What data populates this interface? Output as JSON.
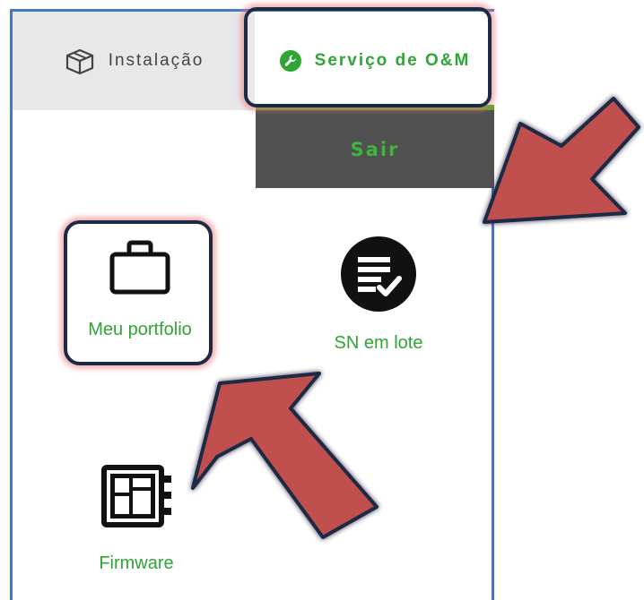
{
  "tabs": {
    "installation_label": "Instalação",
    "om_label": "Serviço de O&M"
  },
  "dropdown": {
    "exit_label": "Sair"
  },
  "tiles": {
    "portfolio_label": "Meu portfolio",
    "batch_sn_label": "SN em lote",
    "firmware_label": "Firmware"
  },
  "icons": {
    "installation": "box-icon",
    "om": "wrench-icon",
    "portfolio": "briefcase-icon",
    "batch_sn": "list-check-icon",
    "firmware": "chip-icon"
  },
  "colors": {
    "accent_green": "#2fa536",
    "tab_bg": "#e8e8e8",
    "dropdown_bg": "#505050",
    "arrow_fill": "#c0504d",
    "highlight_border": "#1e2a45"
  }
}
